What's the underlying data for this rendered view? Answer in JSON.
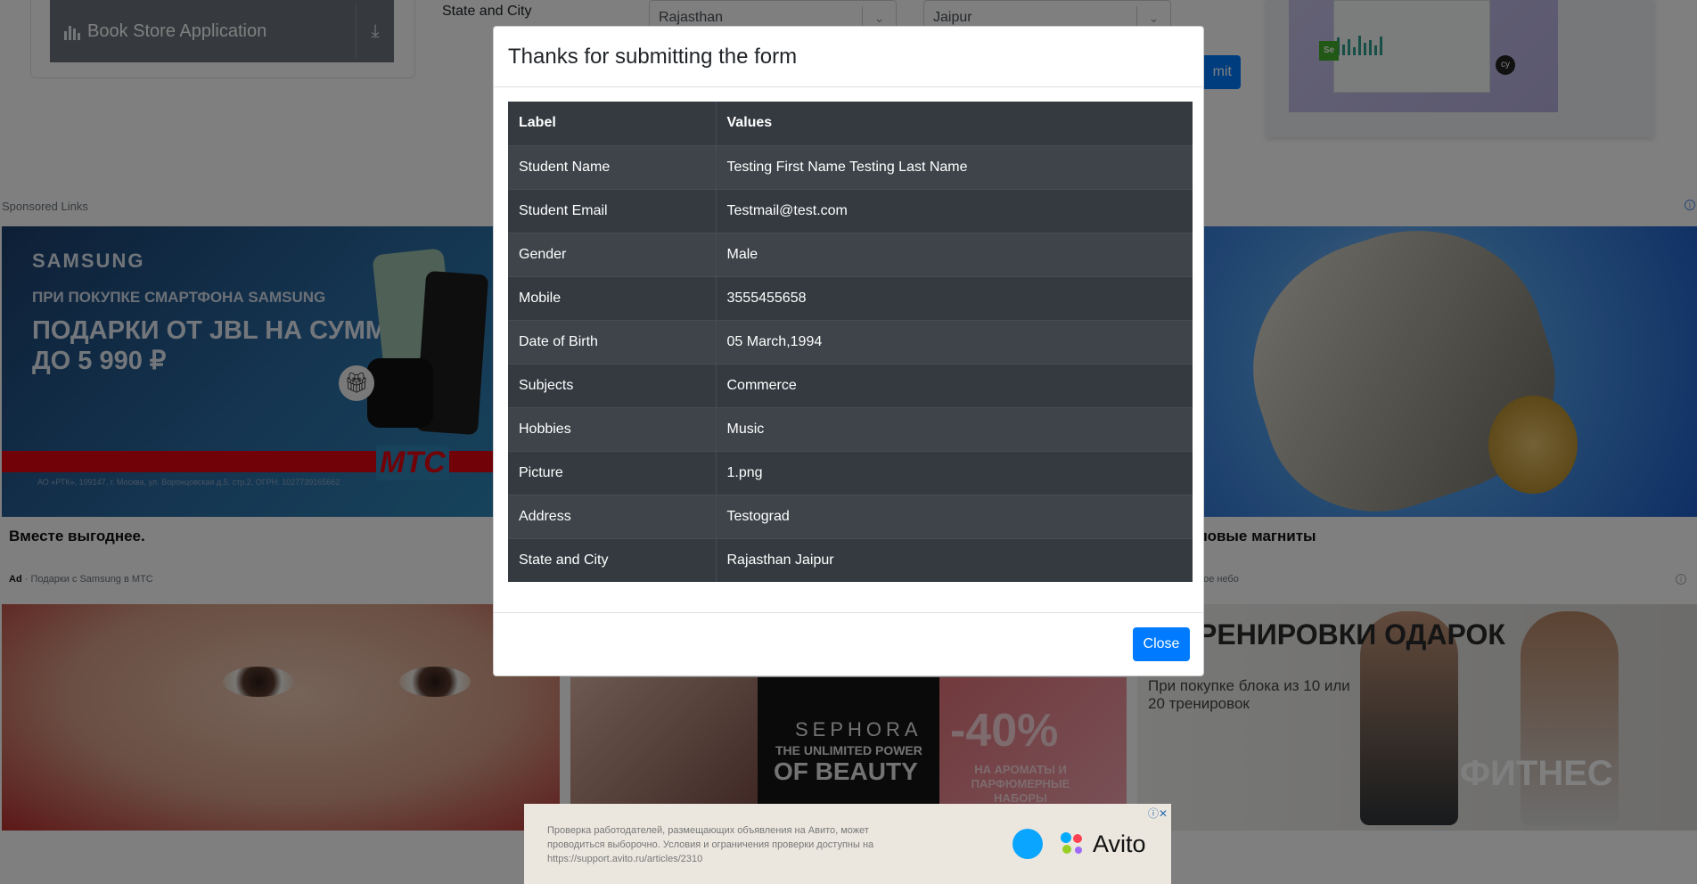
{
  "background": {
    "sidebar": {
      "book_store_label": "Book Store Application"
    },
    "form": {
      "state_city_label": "State and City",
      "state_value": "Rajasthan",
      "city_value": "Jaipur",
      "submit_label": "mit"
    },
    "sponsored": {
      "label": "Sponsored Links",
      "ads": {
        "samsung": {
          "brand": "SAMSUNG",
          "line1": "ПРИ ПОКУПКЕ СМАРТФОНА SAMSUNG",
          "line2": "ПОДАРКИ ОТ JBL НА СУММУ ДО 5 990 ₽",
          "mts": "МТС",
          "legal": "АО «РТК», 109147, г. Москва, ул. Воронцовская д.5, стр.2, ОГРН: 1027739165662",
          "caption": "Вместе выгоднее.",
          "meta_ad": "Ad",
          "meta_text": "Подарки с Samsung в МТС"
        },
        "magnet": {
          "caption": "ловые магниты",
          "meta_text": "ное небо"
        },
        "sephora": {
          "name": "SEPHORA",
          "tag1": "THE UNLIMITED POWER",
          "tag2": "OF BEAUTY",
          "percent": "-40%",
          "sub": "НА АРОМАТЫ И ПАРФЮМЕРНЫЕ НАБОРЫ"
        },
        "fitness": {
          "headline": "РЕНИРОВКИ ОДАРОК",
          "sub": "При покупке блока из 10 или 20 тренировок",
          "big": "ФИТНЕС"
        }
      }
    },
    "avito": {
      "text": "Проверка работодателей, размещающих объявления на Авито, может проводиться выборочно. Условия и ограничения проверки доступны на https://support.avito.ru/articles/2310",
      "brand": "Avito"
    }
  },
  "modal": {
    "title": "Thanks for submitting the form",
    "table": {
      "headers": [
        "Label",
        "Values"
      ],
      "rows": [
        [
          "Student Name",
          "Testing First Name Testing Last Name"
        ],
        [
          "Student Email",
          "Testmail@test.com"
        ],
        [
          "Gender",
          "Male"
        ],
        [
          "Mobile",
          "3555455658"
        ],
        [
          "Date of Birth",
          "05 March,1994"
        ],
        [
          "Subjects",
          "Commerce"
        ],
        [
          "Hobbies",
          "Music"
        ],
        [
          "Picture",
          "1.png"
        ],
        [
          "Address",
          "Testograd"
        ],
        [
          "State and City",
          "Rajasthan Jaipur"
        ]
      ]
    },
    "close_label": "Close"
  },
  "colors": {
    "primary": "#007bff",
    "table_dark": "#343a40",
    "backdrop": "rgba(0,0,0,0.5)"
  },
  "icons": [
    "book-icon",
    "download-icon",
    "chevron-down-icon",
    "info-icon",
    "gift-icon",
    "ad-close-icon"
  ]
}
